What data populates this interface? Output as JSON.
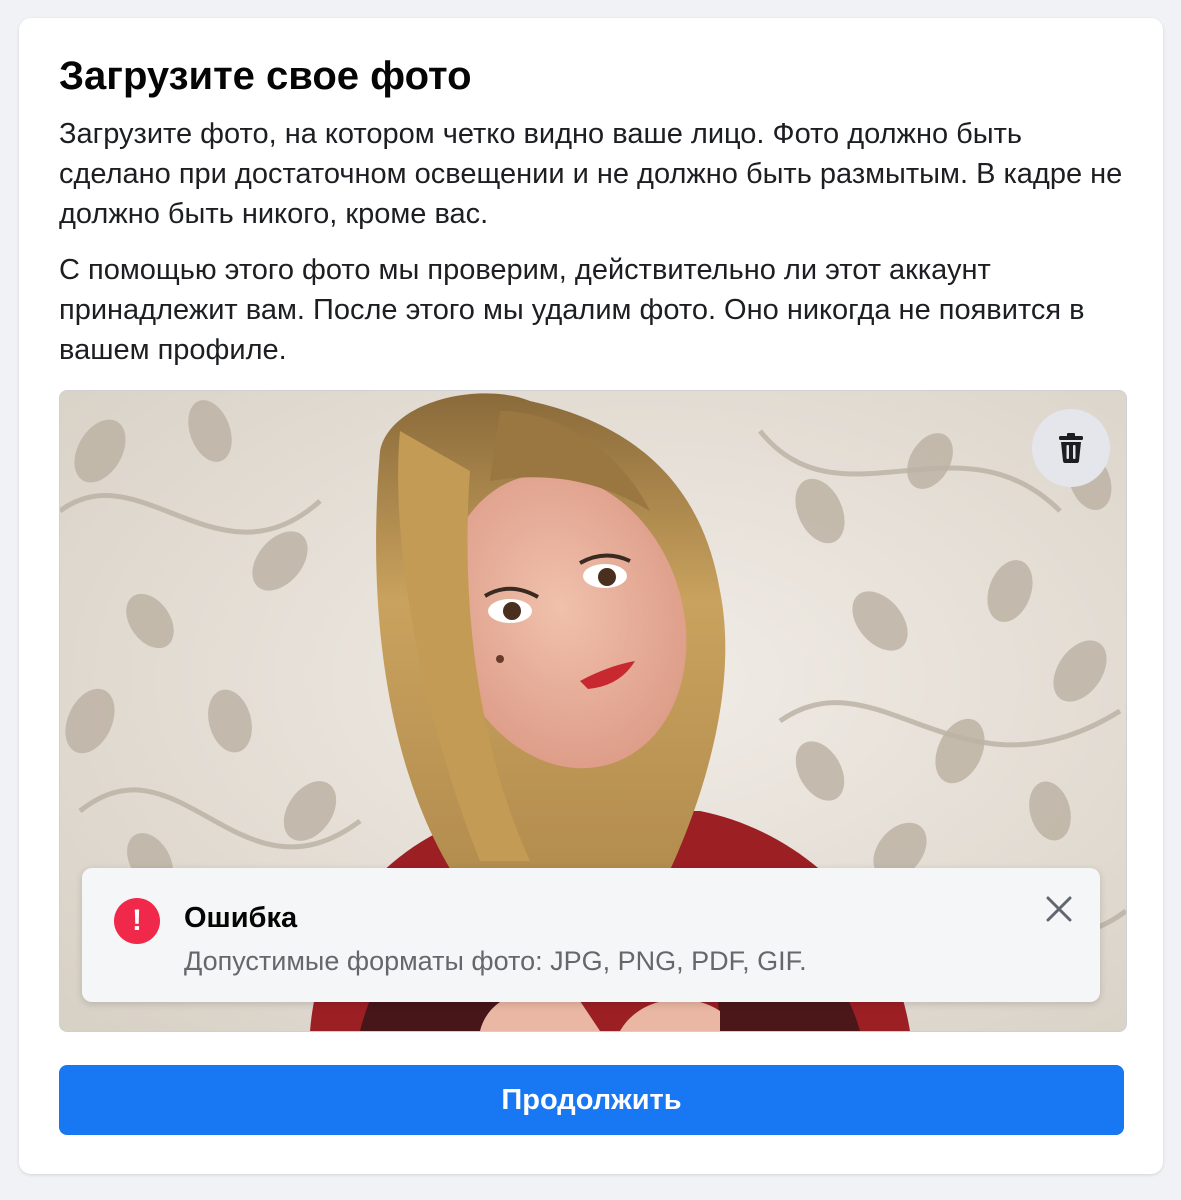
{
  "dialog": {
    "title": "Загрузите свое фото",
    "paragraph1": "Загрузите фото, на котором четко видно ваше лицо. Фото должно быть сделано при достаточном освещении и не должно быть размытым. В кадре не должно быть никого, кроме вас.",
    "paragraph2": "С помощью этого фото мы проверим, действительно ли этот аккаунт принадлежит вам. После этого мы удалим фото. Оно никогда не появится в вашем профиле."
  },
  "photo": {
    "delete_icon": "trash-icon"
  },
  "error": {
    "icon": "exclamation-icon",
    "icon_glyph": "!",
    "title": "Ошибка",
    "message": "Допустимые форматы фото: JPG, PNG, PDF, GIF.",
    "close_icon": "close-icon"
  },
  "actions": {
    "continue_label": "Продолжить"
  },
  "colors": {
    "primary": "#1877f2",
    "error": "#f02849",
    "text": "#050505",
    "secondary_text": "#65676b"
  }
}
